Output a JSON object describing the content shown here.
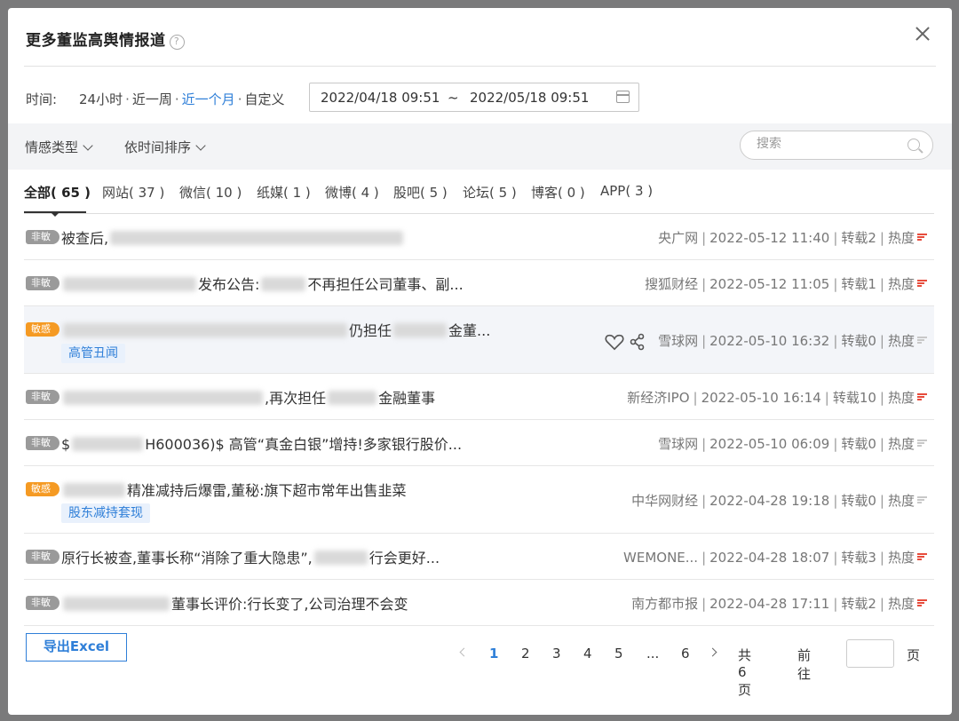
{
  "modal": {
    "title": "更多董监高舆情报道",
    "help_glyph": "?"
  },
  "time": {
    "label": "时间:",
    "options": [
      "24小时",
      "近一周",
      "近一个月",
      "自定义"
    ],
    "separator": "·",
    "active_option": "近一个月",
    "start": "2022/04/18 09:51",
    "tilde": "~",
    "end": "2022/05/18 09:51"
  },
  "filters": {
    "sentiment_label": "情感类型",
    "sort_label": "依时间排序",
    "search_placeholder": "搜索"
  },
  "tabs": [
    {
      "label": "全部( 65 )",
      "active": true
    },
    {
      "label": "网站( 37 )"
    },
    {
      "label": "微信( 10 )"
    },
    {
      "label": "纸媒( 1 )"
    },
    {
      "label": "微博( 4 )"
    },
    {
      "label": "股吧( 5 )"
    },
    {
      "label": "论坛( 5 )"
    },
    {
      "label": "博客( 0 )"
    },
    {
      "label": "APP( 3 )"
    }
  ],
  "rows": [
    {
      "badge": "非敏",
      "title_a": "被查后,",
      "title_b": "",
      "tag": "",
      "source": "央广网",
      "time": "2022-05-12 11:40",
      "reposts": "转载2",
      "heat_label": "热度",
      "heat": "red"
    },
    {
      "badge": "非敏",
      "title_a": "",
      "title_b": "发布公告:",
      "title_c": "不再担任公司董事、副...",
      "tag": "",
      "source": "搜狐财经",
      "time": "2022-05-12 11:05",
      "reposts": "转载1",
      "heat_label": "热度",
      "heat": "red"
    },
    {
      "badge": "敏感",
      "title_a": "",
      "title_b": "仍担任",
      "title_c": "金董...",
      "tag": "高管丑闻",
      "source": "雪球网",
      "time": "2022-05-10 16:32",
      "reposts": "转载0",
      "heat_label": "热度",
      "heat": "gray"
    },
    {
      "badge": "非敏",
      "title_a": "",
      "title_b": ",再次担任",
      "title_c": "金融董事",
      "tag": "",
      "source": "新经济IPO",
      "time": "2022-05-10 16:14",
      "reposts": "转载10",
      "heat_label": "热度",
      "heat": "red"
    },
    {
      "badge": "非敏",
      "title_a": "$",
      "title_b": "H600036)$ 高管“真金白银”增持!多家银行股价...",
      "tag": "",
      "source": "雪球网",
      "time": "2022-05-10 06:09",
      "reposts": "转载0",
      "heat_label": "热度",
      "heat": "gray"
    },
    {
      "badge": "敏感",
      "title_a": "",
      "title_b": "精准减持后爆雷,董秘:旗下超市常年出售韭菜",
      "tag": "股东减持套现",
      "source": "中华网财经",
      "time": "2022-04-28 19:18",
      "reposts": "转载0",
      "heat_label": "热度",
      "heat": "gray"
    },
    {
      "badge": "非敏",
      "title_a": "原行长被查,董事长称“消除了重大隐患”,",
      "title_b": "行会更好...",
      "tag": "",
      "source": "WEMONE...",
      "time": "2022-04-28 18:07",
      "reposts": "转载3",
      "heat_label": "热度",
      "heat": "red"
    },
    {
      "badge": "非敏",
      "title_a": "",
      "title_b": "董事长评价:行长变了,公司治理不会变",
      "tag": "",
      "source": "南方都市报",
      "time": "2022-04-28 17:11",
      "reposts": "转载2",
      "heat_label": "热度",
      "heat": "red"
    }
  ],
  "footer": {
    "export_label": "导出Excel",
    "pages": [
      "1",
      "2",
      "3",
      "4",
      "5",
      "...",
      "6"
    ],
    "active_page": "1",
    "total": "共6页",
    "goto_label": "前往",
    "page_unit": "页"
  },
  "colors": {
    "accent": "#2f7fd8",
    "sensitive": "#f59a23",
    "neutral": "#9a9a9a",
    "heat_red": "#e74c3c"
  }
}
